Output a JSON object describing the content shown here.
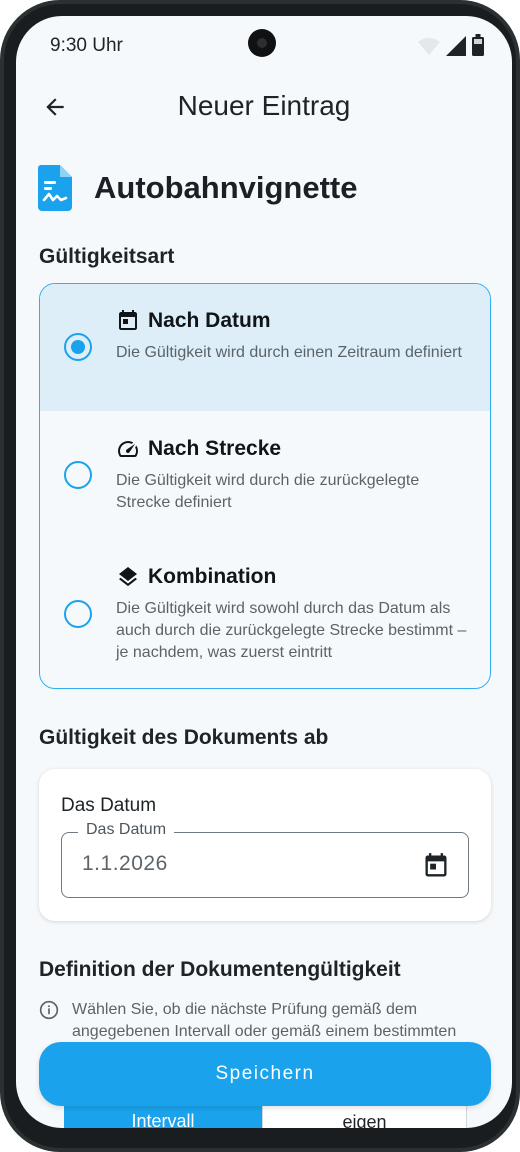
{
  "status_bar": {
    "time": "9:30 Uhr",
    "icons": [
      "wifi-icon",
      "signal-icon",
      "battery-icon"
    ]
  },
  "app_bar": {
    "title": "Neuer Eintrag",
    "back_icon": "arrow-left-icon"
  },
  "document": {
    "title": "Autobahnvignette",
    "icon": "document-icon"
  },
  "validity_type": {
    "label": "Gültigkeitsart",
    "options": [
      {
        "title": "Nach Datum",
        "description": "Die Gültigkeit wird durch einen Zeitraum definiert",
        "icon": "calendar-icon",
        "selected": true
      },
      {
        "title": "Nach Strecke",
        "description": "Die Gültigkeit wird durch die zurückgelegte Strecke definiert",
        "icon": "speedometer-icon",
        "selected": false
      },
      {
        "title": "Kombination",
        "description": "Die Gültigkeit wird sowohl durch das Datum als auch durch die zurückgelegte Strecke bestimmt – je nachdem, was zuerst eintritt",
        "icon": "layers-icon",
        "selected": false
      }
    ]
  },
  "valid_from": {
    "label": "Gültigkeit des Dokuments ab",
    "card_label": "Das Datum",
    "field_label": "Das Datum",
    "field_value": "1.1.2026",
    "field_icon": "calendar-icon"
  },
  "definition": {
    "label": "Definition der Dokumentengültigkeit",
    "info_text": "Wählen Sie, ob die nächste Prüfung gemäß dem angegebenen Intervall oder gemäß einem bestimmten",
    "info_icon": "info-icon",
    "segments": [
      "Intervall",
      "eigen"
    ],
    "active_segment": "Intervall"
  },
  "actions": {
    "save_label": "Speichern"
  },
  "colors": {
    "accent": "#1aa3ec",
    "selected_bg": "#ddeef8",
    "screen_bg": "#f6f9fb",
    "text": "#1d2327"
  }
}
